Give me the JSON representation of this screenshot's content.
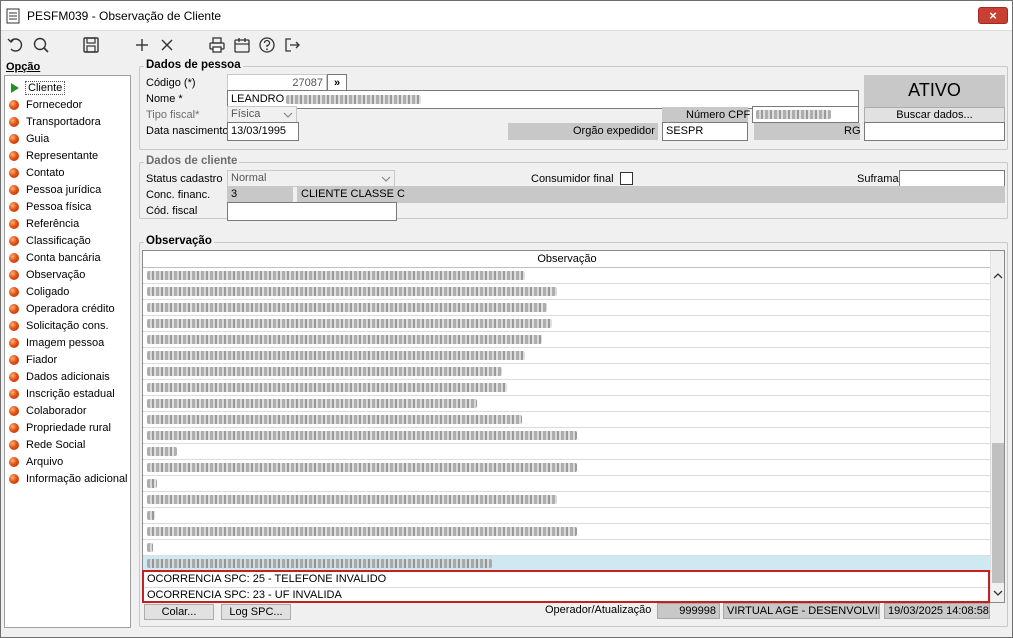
{
  "window": {
    "title": "PESFM039 - Observação de Cliente",
    "close_label": "×"
  },
  "toolbar": {
    "icons": [
      "undo-icon",
      "search-icon",
      "save-icon",
      "add-icon",
      "delete-icon",
      "print-icon",
      "calendar-icon",
      "help-icon",
      "exit-icon"
    ]
  },
  "sidebar": {
    "heading": "Opção",
    "items": [
      {
        "label": "Cliente"
      },
      {
        "label": "Fornecedor"
      },
      {
        "label": "Transportadora"
      },
      {
        "label": "Guia"
      },
      {
        "label": "Representante"
      },
      {
        "label": "Contato"
      },
      {
        "label": "Pessoa jurídica"
      },
      {
        "label": "Pessoa física"
      },
      {
        "label": "Referência"
      },
      {
        "label": "Classificação"
      },
      {
        "label": "Conta bancária"
      },
      {
        "label": "Observação"
      },
      {
        "label": "Coligado"
      },
      {
        "label": "Operadora crédito"
      },
      {
        "label": "Solicitação cons."
      },
      {
        "label": "Imagem pessoa"
      },
      {
        "label": "Fiador"
      },
      {
        "label": "Dados adicionais"
      },
      {
        "label": "Inscrição estadual"
      },
      {
        "label": "Colaborador"
      },
      {
        "label": "Propriedade rural"
      },
      {
        "label": "Rede Social"
      },
      {
        "label": "Arquivo"
      },
      {
        "label": "Informação adicional"
      }
    ]
  },
  "pessoa": {
    "group_title": "Dados de pessoa",
    "codigo_label": "Código (*)",
    "codigo_value": "27087",
    "codigo_nav": "»",
    "nome_label": "Nome *",
    "nome_value": "LEANDRO",
    "tipo_fiscal_label": "Tipo fiscal*",
    "tipo_fiscal_value": "Física",
    "data_nasc_label": "Data nascimento",
    "data_nasc_value": "13/03/1995",
    "numero_cpf_label": "Número CPF",
    "orgao_label": "Orgão expedidor",
    "orgao_value": "SESPR",
    "rg_label": "RG",
    "status": "ATIVO",
    "buscar_button": "Buscar dados..."
  },
  "cliente": {
    "group_title": "Dados de cliente",
    "status_cadastro_label": "Status cadastro",
    "status_cadastro_value": "Normal",
    "consumidor_final_label": "Consumidor final",
    "suframa_label": "Suframa",
    "conc_financ_label": "Conc. financ.",
    "conc_financ_code": "3",
    "conc_financ_desc": "CLIENTE CLASSE C",
    "cod_fiscal_label": "Cód. fiscal"
  },
  "observacao": {
    "group_title": "Observação",
    "column_header": "Observação",
    "visible_rows": [
      "OCORRENCIA SPC: 25 - TELEFONE INVALIDO",
      "OCORRENCIA SPC: 23 - UF INVALIDA"
    ],
    "scroll_up_icon": "chevron-up-icon",
    "scroll_down_icon": "chevron-down-icon"
  },
  "footer": {
    "colar_button": "Colar...",
    "log_spc_button": "Log SPC...",
    "operador_label": "Operador/Atualização",
    "operador_code": "999998",
    "operador_name": "VIRTUAL AGE - DESENVOLVIM",
    "timestamp": "19/03/2025 14:08:58"
  }
}
